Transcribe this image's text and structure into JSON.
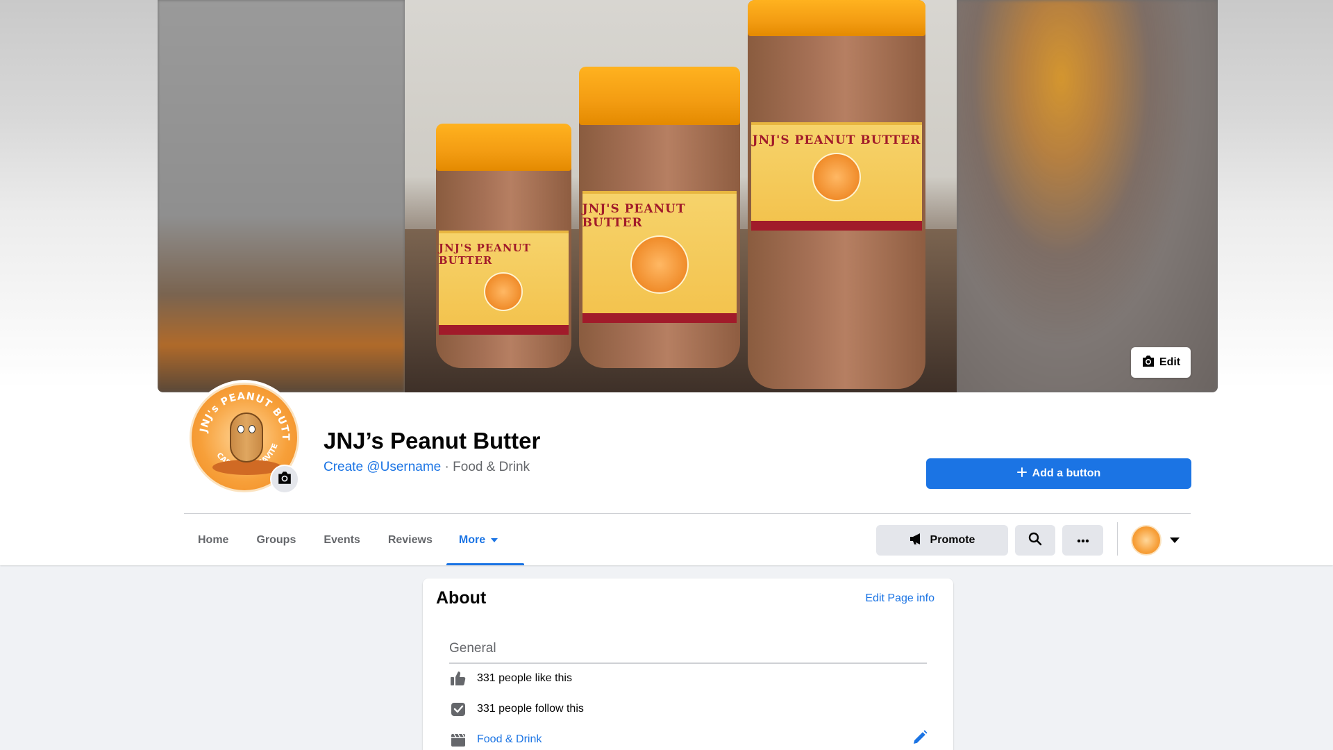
{
  "cover": {
    "edit_label": "Edit",
    "jar_label_text": "JNJ'S PEANUT BUTTER"
  },
  "profile": {
    "name": "JNJ’s Peanut Butter",
    "username_link": "Create @Username",
    "separator": " · ",
    "category": "Food & Drink",
    "add_button_label": "Add a button",
    "avatar_ring_top": "JNJ's PEANUT BUTTER",
    "avatar_ring_bottom": "CARMONA, CAVITE"
  },
  "tabs": [
    {
      "label": "Home"
    },
    {
      "label": "Groups"
    },
    {
      "label": "Events"
    },
    {
      "label": "Reviews"
    },
    {
      "label": "More",
      "active": true
    }
  ],
  "actions": {
    "promote_label": "Promote",
    "search_icon": "search-icon",
    "more_icon": "ellipsis-icon"
  },
  "about": {
    "title": "About",
    "edit_link": "Edit Page info",
    "section": "General",
    "likes": "331 people like this",
    "follows": "331 people follow this",
    "category_link": "Food & Drink"
  },
  "colors": {
    "accent": "#1b74e4",
    "page_bg": "#f0f2f5",
    "secondary_btn": "#e4e6eb"
  }
}
